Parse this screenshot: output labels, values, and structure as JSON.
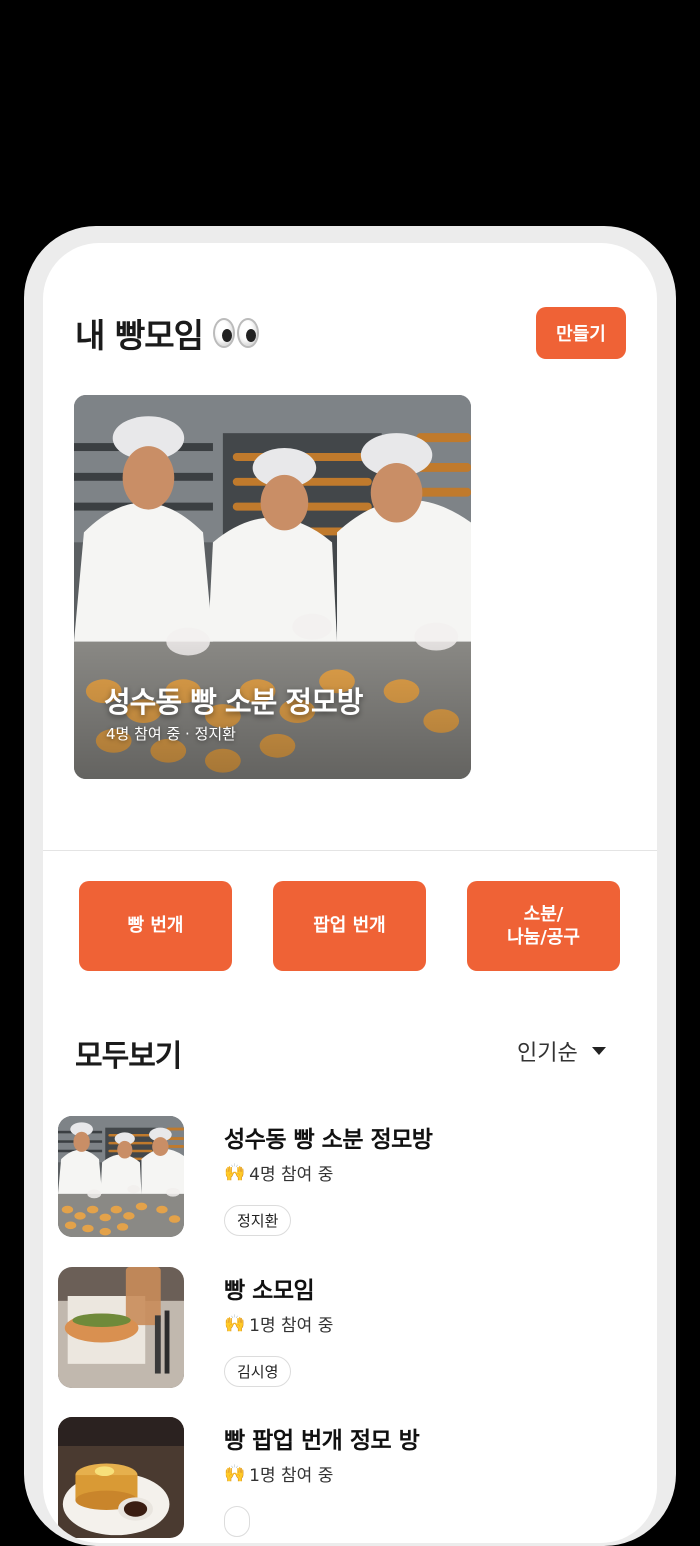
{
  "header": {
    "title": "내 빵모임",
    "create_label": "만들기"
  },
  "featured": {
    "title": "성수동 빵 소분 정모방",
    "meta": "4명 참여 중 · 정지환"
  },
  "categories": [
    "빵 번개",
    "팝업 번개",
    "소분/\n나눔/공구"
  ],
  "all_section": {
    "title": "모두보기",
    "sort_label": "인기순"
  },
  "groups": [
    {
      "title": "성수동 빵 소분 정모방",
      "participants": "4명 참여 중",
      "host": "정지환"
    },
    {
      "title": "빵 소모임",
      "participants": "1명 참여 중",
      "host": "김시영"
    },
    {
      "title": "빵 팝업 번개 정모 방",
      "participants": "1명 참여 중",
      "host": ""
    }
  ],
  "colors": {
    "accent": "#ef6236",
    "background": "#000000"
  }
}
